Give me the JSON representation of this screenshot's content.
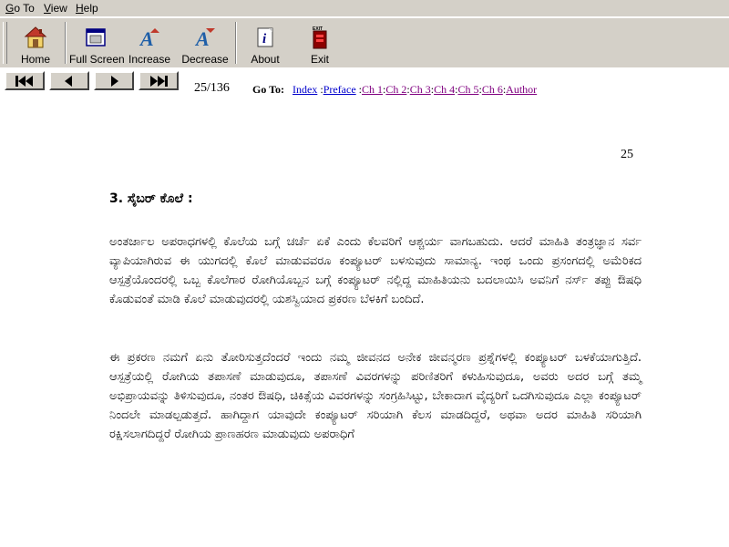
{
  "menu": {
    "goto": "Go To",
    "view": "View",
    "help": "Help"
  },
  "toolbar": {
    "home": "Home",
    "fullscreen": "Full Screen",
    "increase": "Increase",
    "decrease": "Decrease",
    "about": "About",
    "exit": "Exit",
    "exit_badge": "EXIT"
  },
  "nav": {
    "page": "25/136",
    "goto_label": "Go To:",
    "links": [
      "Index",
      "Preface",
      "Ch 1",
      "Ch 2",
      "Ch 3",
      "Ch 4",
      "Ch 5",
      "Ch 6",
      "Author"
    ]
  },
  "document": {
    "page_number": "25",
    "heading": "3. ಸೈಬರ್ ಕೊಲೆ :",
    "paragraph1": "ಅಂತರ್ಜಾಲ ಅಪರಾಧಗಳಲ್ಲಿ ಕೊಲೆಯ ಬಗ್ಗೆ ಚರ್ಚೆ ಏಕೆ ಎಂದು ಕೆಲವರಿಗೆ ಆಶ್ಚರ್ಯ ವಾಗಬಹುದು. ಆದರೆ ಮಾಹಿತಿ ತಂತ್ರಜ್ಞಾನ ಸರ್ವ ವ್ಯಾಪಿಯಾಗಿರುವ ಈ ಯುಗದಲ್ಲಿ ಕೊಲೆ ಮಾಡುವವರೂ ಕಂಪ್ಯೂಟರ್ ಬಳಸುವುದು ಸಾಮಾನ್ಯ. ಇಂಥ ಒಂದು ಪ್ರಸಂಗದಲ್ಲಿ ಅಮೆರಿಕದ ಆಸ್ಪತ್ರೆಯೊಂದರಲ್ಲಿ ಒಬ್ಬ ಕೊಲೆಗಾರ ರೋಗಿಯೊಬ್ಬನ ಬಗ್ಗೆ ಕಂಪ್ಯೂಟರ್ ನಲ್ಲಿದ್ದ ಮಾಹಿತಿಯನು ಬದಲಾಯಿಸಿ ಅವನಿಗೆ ನರ್ಸ್ ತಪ್ಪು ಔಷಧಿ ಕೊಡುವಂತೆ ಮಾಡಿ ಕೊಲೆ ಮಾಡುವುದರಲ್ಲಿ ಯಶಸ್ವಿಯಾದ ಪ್ರಕರಣ ಬೆಳಕಿಗೆ ಬಂದಿದೆ.",
    "paragraph2": "ಈ ಪ್ರಕರಣ ನಮಗೆ ಏನು ತೋರಿಸುತ್ತದೆಂದರೆ ಇಂದು ನಮ್ಮ ಜೀವನದ ಅನೇಕ ಜೀವನ್ಮರಣ ಪ್ರಶ್ನೆಗಳಲ್ಲಿ ಕಂಪ್ಯೂಟರ್ ಬಳಕೆಯಾಗುತ್ತಿದೆ. ಆಸ್ಪತ್ರೆಯಲ್ಲಿ ರೋಗಿಯ ತಪಾಸಣೆ ಮಾಡುವುದೂ, ತಪಾಸಣೆ ವಿವರಗಳನ್ನು ಪರಿಣಿತರಿಗೆ ಕಳುಹಿಸುವುದೂ, ಅವರು ಅದರ ಬಗ್ಗೆ ತಮ್ಮ ಅಭಿಪ್ರಾಯವನ್ನು ತಿಳಿಸುವುದೂ, ನಂತರ ಔಷಧಿ, ಚಿಕಿತ್ಸೆಯ ವಿವರಗಳನ್ನು ಸಂಗ್ರಹಿಸಿಟ್ಟು, ಬೇಕಾದಾಗ ವೈದ್ಯರಿಗೆ ಒದಗಿಸುವುದೂ ಎಲ್ಲಾ ಕಂಪ್ಯೂಟರ್ ನಿಂದಲೇ ಮಾಡಲ್ಪಡುತ್ತದೆ. ಹಾಗಿದ್ದಾಗ ಯಾವುದೇ ಕಂಪ್ಯೂಟರ್ ಸರಿಯಾಗಿ ಕೆಲಸ ಮಾಡದಿದ್ದರೆ, ಅಥವಾ ಅದರ ಮಾಹಿತಿ ಸರಿಯಾಗಿ ರಕ್ಷಿಸಲಾಗದಿದ್ದರೆ ರೋಗಿಯ ಪ್ರಾಣಹರಣ ಮಾಡುವುದು ಅಪರಾಧಿಗೆ"
  }
}
